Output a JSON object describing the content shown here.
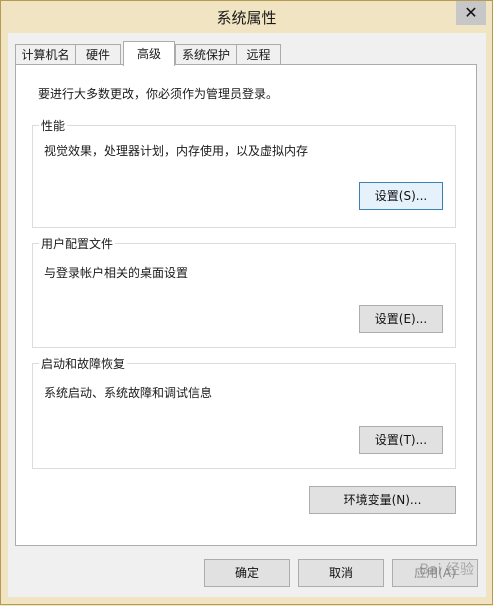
{
  "window": {
    "title": "系统属性",
    "close_glyph": "✕"
  },
  "tabs": [
    {
      "label": "计算机名",
      "active": false
    },
    {
      "label": "硬件",
      "active": false
    },
    {
      "label": "高级",
      "active": true
    },
    {
      "label": "系统保护",
      "active": false
    },
    {
      "label": "远程",
      "active": false
    }
  ],
  "advanced": {
    "admin_note": "要进行大多数更改，你必须作为管理员登录。",
    "performance": {
      "title": "性能",
      "description": "视觉效果，处理器计划，内存使用，以及虚拟内存",
      "button": "设置(S)..."
    },
    "user_profiles": {
      "title": "用户配置文件",
      "description": "与登录帐户相关的桌面设置",
      "button": "设置(E)..."
    },
    "startup_recovery": {
      "title": "启动和故障恢复",
      "description": "系统启动、系统故障和调试信息",
      "button": "设置(T)..."
    },
    "env_button": "环境变量(N)..."
  },
  "footer": {
    "ok": "确定",
    "cancel": "取消",
    "apply": "应用(A)"
  },
  "watermark": "Bai 经验",
  "colors": {
    "titlebar": "#f0e4c3",
    "annotation_arrow": "#e8352c",
    "focus_border": "#3c7fb1"
  }
}
